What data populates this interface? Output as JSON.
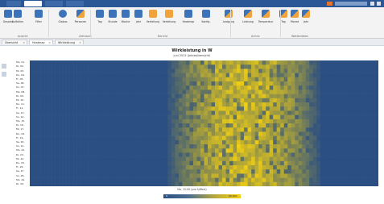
{
  "ribbon": {
    "buttons": [
      {
        "label": "Gesamt",
        "icon": "table-icon",
        "color": "blue"
      },
      {
        "label": "Aufteilen",
        "icon": "split-icon",
        "color": "blue"
      },
      {
        "label": "Filter",
        "icon": "filter-icon",
        "color": "blue"
      },
      {
        "label": "Globus",
        "icon": "globe-icon",
        "color": "globe"
      },
      {
        "label": "Personen",
        "icon": "people-icon",
        "color": "mixed"
      },
      {
        "label": "Tag",
        "icon": "day-icon",
        "color": "blue"
      },
      {
        "label": "Stunde",
        "icon": "hour-icon",
        "color": "blue"
      },
      {
        "label": "Woche",
        "icon": "week-icon",
        "color": "blue"
      },
      {
        "label": "Jahr",
        "icon": "year-icon",
        "color": "blue"
      },
      {
        "label": "Verteilung",
        "icon": "distribution-icon",
        "color": "orange"
      },
      {
        "label": "Verteilung",
        "icon": "distribution2-icon",
        "color": "orange"
      },
      {
        "label": "Heatmap",
        "icon": "heatmap-icon",
        "color": "blue"
      },
      {
        "label": "Konfig.",
        "icon": "config-icon",
        "color": "blue"
      },
      {
        "label": "Lastgang",
        "icon": "loadcurve-icon",
        "color": "mixed"
      },
      {
        "label": "Leistung",
        "icon": "power-icon",
        "color": "mixed"
      },
      {
        "label": "Temperatur",
        "icon": "temperature-icon",
        "color": "mixed"
      },
      {
        "label": "Tag",
        "icon": "day2-icon",
        "color": "mixed"
      },
      {
        "label": "Monat",
        "icon": "month-icon",
        "color": "mixed"
      },
      {
        "label": "Jahr",
        "icon": "year2-icon",
        "color": "mixed"
      }
    ],
    "groups": [
      "Ansicht",
      "Zeitraum",
      "Bericht",
      "Archiv",
      "Wetterdaten"
    ]
  },
  "doc_tabs": [
    {
      "label": "Übersicht",
      "active": false
    },
    {
      "label": "Heatmap",
      "active": true
    },
    {
      "label": "Wirkleistung",
      "active": false
    }
  ],
  "chart": {
    "title": "Wirkleistung in W",
    "subtitle": "Juni 2015 (Jahresübersicht)",
    "xlabel": "Mo, 12:00 (pro h/Wert)",
    "colorbar_min": "0",
    "colorbar_max": "60.000"
  },
  "chart_data": {
    "type": "heatmap",
    "title": "Wirkleistung in W",
    "rows": [
      "Mo, 01.",
      "Di, 02.",
      "Mi, 03.",
      "Do, 04.",
      "Fr, 05.",
      "Sa, 06.",
      "So, 07.",
      "Mo, 08.",
      "Di, 09.",
      "Mi, 10.",
      "Do, 11.",
      "Fr, 12.",
      "Sa, 13.",
      "So, 14.",
      "Mo, 15.",
      "Di, 16.",
      "Mi, 17.",
      "Do, 18.",
      "Fr, 19.",
      "Sa, 20.",
      "So, 21.",
      "Mo, 22.",
      "Di, 23.",
      "Mi, 24.",
      "Do, 25.",
      "Fr, 26.",
      "Sa, 27.",
      "So, 28.",
      "Mo, 29.",
      "Di, 30."
    ],
    "columns": 96,
    "active_column_range": [
      37,
      80
    ],
    "value_range": [
      0,
      60000
    ],
    "colors": {
      "low": "#2b4f82",
      "high": "#f3d011"
    }
  }
}
